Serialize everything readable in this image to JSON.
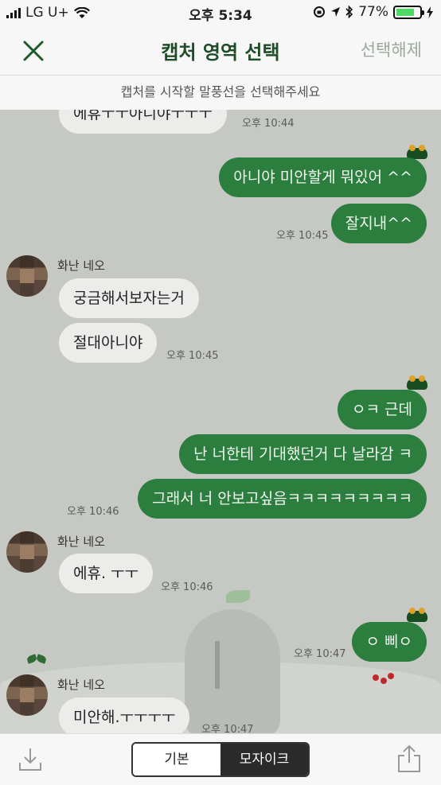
{
  "status_bar": {
    "carrier": "LG U+",
    "time": "오후 5:34",
    "battery_percent": "77%",
    "battery_level": 0.77
  },
  "header": {
    "close_icon": "close-icon",
    "title": "캡처 영역 선택",
    "deselect_label": "선택해제"
  },
  "hint": "캡처를 시작할 말풍선을 선택해주세요",
  "chat": {
    "messages": [
      {
        "side": "in",
        "text": "에휴ㅜㅜ아니야ㅜㅜㅜ",
        "time": "오후 10:44"
      },
      {
        "side": "out",
        "text": "아니야 미안할게 뭐있어 ^^"
      },
      {
        "side": "out",
        "text": "잘지내^^",
        "time": "오후 10:45"
      },
      {
        "side": "in",
        "sender": "화난 네오",
        "text": "궁금해서보자는거"
      },
      {
        "side": "in",
        "text": "절대아니야",
        "time": "오후 10:45"
      },
      {
        "side": "out",
        "text": "ㅇㅋ 근데"
      },
      {
        "side": "out",
        "text": "난 너한테 기대했던거 다 날라감 ㅋ"
      },
      {
        "side": "out",
        "text": "그래서 너 안보고싶음ㅋㅋㅋㅋㅋㅋㅋㅋㅋ",
        "time": "오후 10:46"
      },
      {
        "side": "in",
        "sender": "화난 네오",
        "text": "에휴. ㅜㅜ",
        "time": "오후 10:46"
      },
      {
        "side": "out",
        "text": "ㅇ 삐ㅇ",
        "time": "오후 10:47"
      },
      {
        "side": "in",
        "sender": "화난 네오",
        "text": "미안해.ㅜㅜㅜㅜ",
        "time": "오후 10:47"
      }
    ]
  },
  "bottom_bar": {
    "download_icon": "download-icon",
    "share_icon": "share-icon",
    "mode_options": [
      "기본",
      "모자이크"
    ],
    "selected_mode": "모자이크"
  },
  "colors": {
    "accent_green": "#2b7e3e",
    "header_title": "#1f4d27",
    "chat_background": "#c6c8c4"
  }
}
